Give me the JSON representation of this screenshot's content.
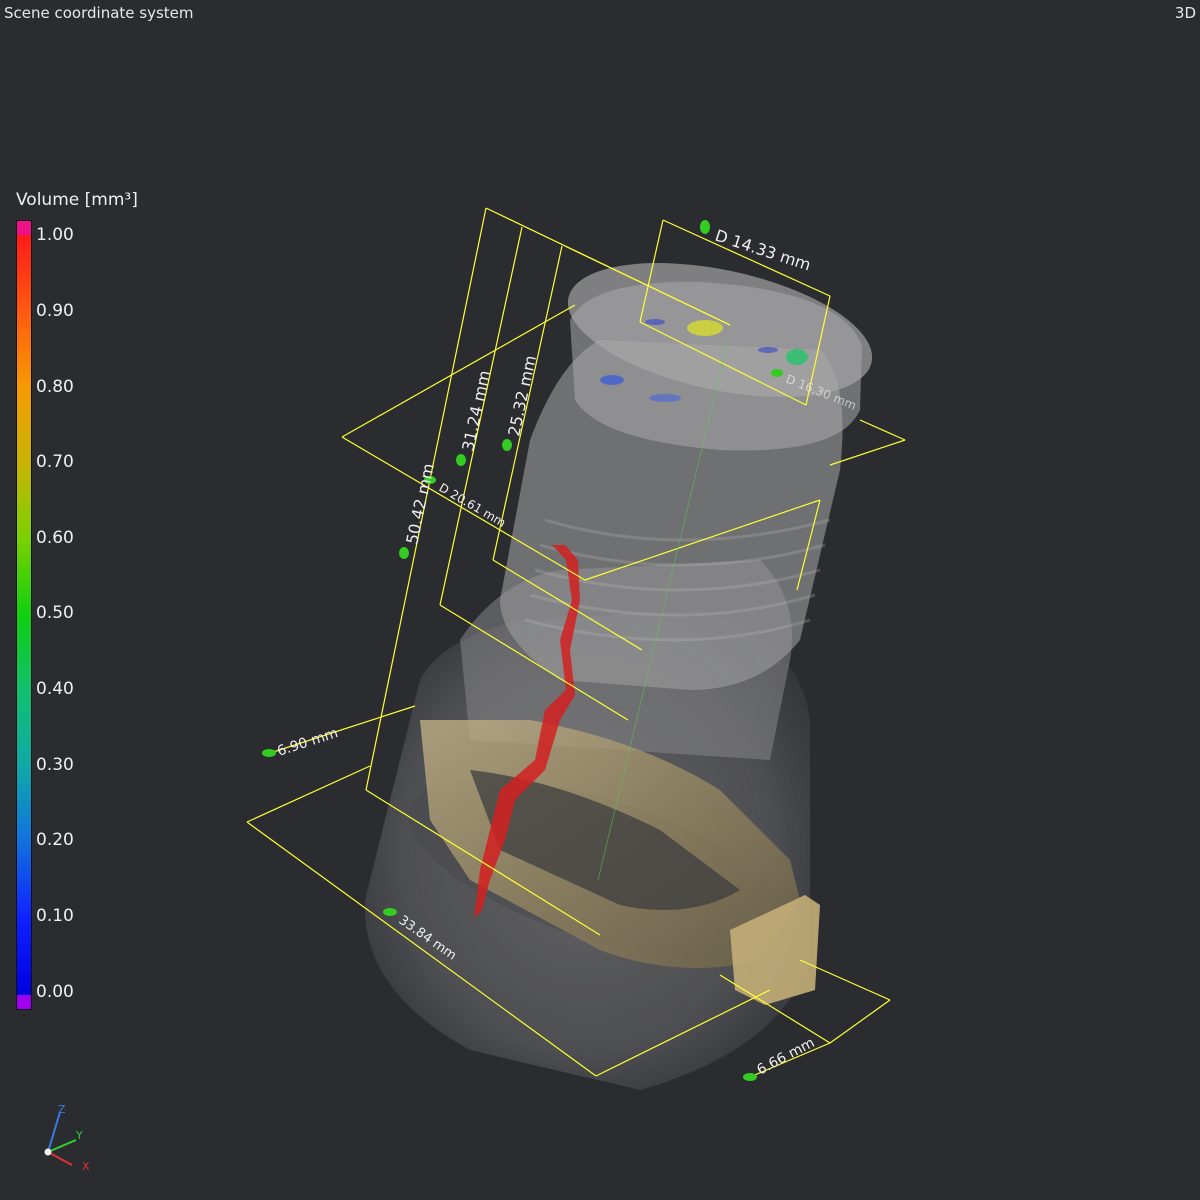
{
  "header": {
    "title": "Scene coordinate system",
    "view_mode": "3D"
  },
  "legend": {
    "title": "Volume [mm³]",
    "ticks": [
      "1.00",
      "0.90",
      "0.80",
      "0.70",
      "0.60",
      "0.50",
      "0.40",
      "0.30",
      "0.20",
      "0.10",
      "0.00"
    ]
  },
  "measurements": {
    "diameter_top": "D 14.33 mm",
    "diameter_mid": "D 20.61 mm",
    "diameter_inner": "D 16.30 mm",
    "len_50": "50.42 mm",
    "len_31": "31.24 mm",
    "len_25": "25.32 mm",
    "len_6_90": "6.90 mm",
    "len_33": "33.84 mm",
    "len_6_66": "6.66 mm"
  },
  "axes": {
    "z": "Z",
    "y": "Y",
    "x": "X"
  },
  "colors": {
    "background": "#2b2c30",
    "dimension_line": "#ffff33",
    "defect": "#d42020",
    "marker": "#33cc22"
  }
}
